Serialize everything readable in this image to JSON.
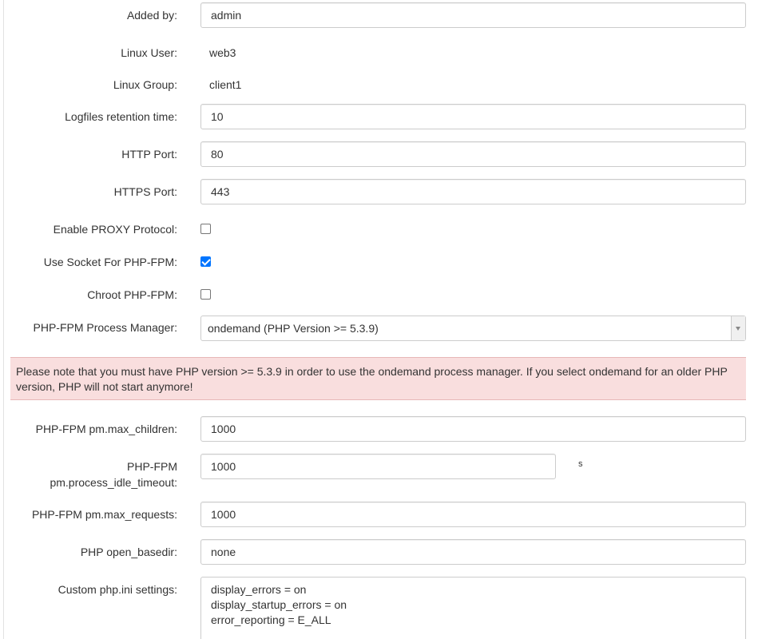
{
  "form": {
    "added_by": {
      "label": "Added by:",
      "value": "admin"
    },
    "linux_user": {
      "label": "Linux User:",
      "value": "web3"
    },
    "linux_group": {
      "label": "Linux Group:",
      "value": "client1"
    },
    "logfiles_retention": {
      "label": "Logfiles retention time:",
      "value": "10"
    },
    "http_port": {
      "label": "HTTP Port:",
      "value": "80"
    },
    "https_port": {
      "label": "HTTPS Port:",
      "value": "443"
    },
    "enable_proxy": {
      "label": "Enable PROXY Protocol:",
      "checked": false
    },
    "socket_php_fpm": {
      "label": "Use Socket For PHP-FPM:",
      "checked": true
    },
    "chroot_php_fpm": {
      "label": "Chroot PHP-FPM:",
      "checked": false
    },
    "process_manager": {
      "label": "PHP-FPM Process Manager:",
      "selected": "ondemand (PHP Version >= 5.3.9)"
    },
    "alert_text": "Please note that you must have PHP version >= 5.3.9 in order to use the ondemand process manager. If you select ondemand for an older PHP version, PHP will not start anymore!",
    "max_children": {
      "label": "PHP-FPM pm.max_children:",
      "value": "1000"
    },
    "idle_timeout": {
      "label_line1": "PHP-FPM",
      "label_line2": "pm.process_idle_timeout:",
      "value": "1000",
      "unit": "s"
    },
    "max_requests": {
      "label": "PHP-FPM pm.max_requests:",
      "value": "1000"
    },
    "open_basedir": {
      "label": "PHP open_basedir:",
      "value": "none"
    },
    "custom_ini": {
      "label": "Custom php.ini settings:",
      "lines": [
        "display_errors = on",
        "display_startup_errors = on",
        "error_reporting = E_ALL"
      ]
    }
  },
  "colors": {
    "alert_background": "#f9dede",
    "checkbox_checked": "#0075ff",
    "input_border": "#cccccc"
  }
}
